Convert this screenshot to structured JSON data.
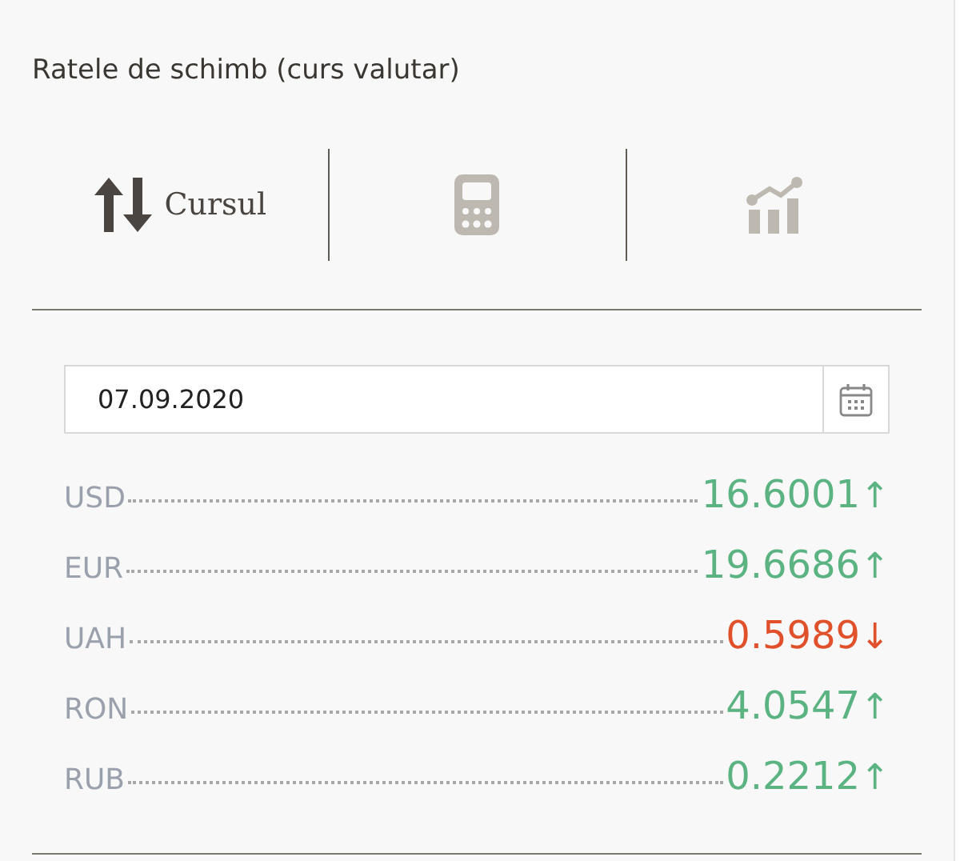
{
  "title": "Ratele de schimb (curs valutar)",
  "tabs": [
    {
      "kind": "rates",
      "label": "Cursul",
      "selected": true
    },
    {
      "kind": "calculator",
      "selected": false
    },
    {
      "kind": "chart",
      "selected": false
    }
  ],
  "date_field": {
    "value": "07.09.2020"
  },
  "rates": [
    {
      "currency": "USD",
      "value": "16.6001",
      "arrow": "↑",
      "rising": true
    },
    {
      "currency": "EUR",
      "value": "19.6686",
      "arrow": "↑",
      "rising": true
    },
    {
      "currency": "UAH",
      "value": "0.5989",
      "arrow": "↓",
      "rising": false
    },
    {
      "currency": "RON",
      "value": "4.0547",
      "arrow": "↑",
      "rising": true
    },
    {
      "currency": "RUB",
      "value": "0.2212",
      "arrow": "↑",
      "rising": true
    }
  ]
}
